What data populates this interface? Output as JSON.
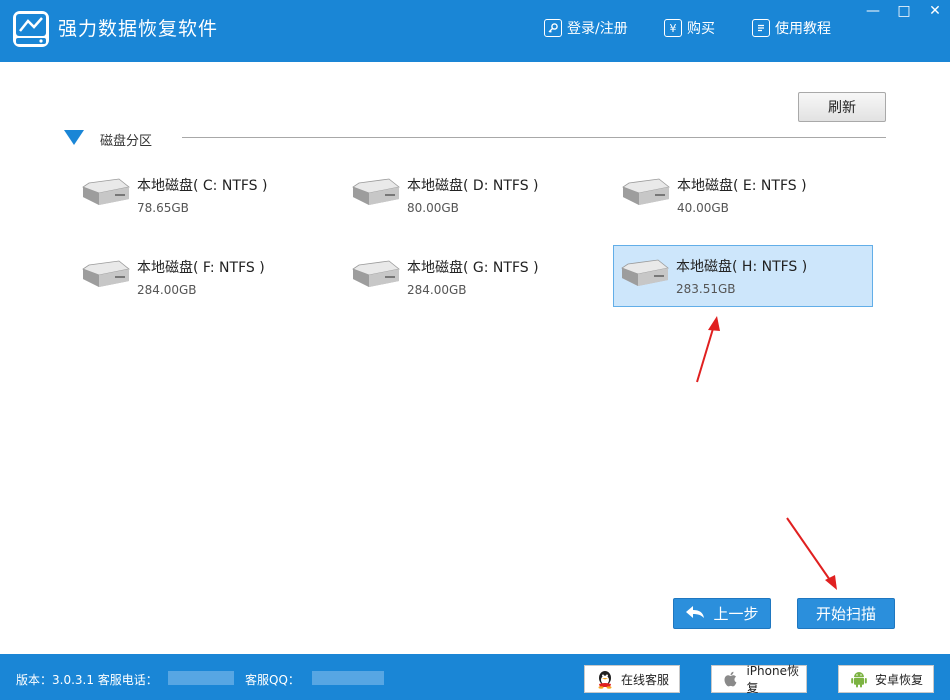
{
  "app": {
    "title": "强力数据恢复软件"
  },
  "header": {
    "login_label": "登录/注册",
    "buy_label": "购买",
    "buy_icon_glyph": "¥",
    "tutorial_label": "使用教程",
    "window_controls": [
      "—",
      "□",
      "✕"
    ]
  },
  "toolbar": {
    "refresh_label": "刷新"
  },
  "section": {
    "title": "磁盘分区"
  },
  "drives": [
    {
      "name": "本地磁盘( C: NTFS )",
      "size": "78.65GB"
    },
    {
      "name": "本地磁盘( D: NTFS )",
      "size": "80.00GB"
    },
    {
      "name": "本地磁盘( E: NTFS )",
      "size": "40.00GB"
    },
    {
      "name": "本地磁盘( F: NTFS )",
      "size": "284.00GB"
    },
    {
      "name": "本地磁盘( G: NTFS )",
      "size": "284.00GB"
    },
    {
      "name": "本地磁盘( H: NTFS )",
      "size": "283.51GB"
    }
  ],
  "selected_drive": "H",
  "actions": {
    "back_label": "上一步",
    "start_scan_label": "开始扫描"
  },
  "footer": {
    "version_label": "版本：3.0.3.1  客服电话：",
    "qq_label": "客服QQ：",
    "online_service_label": "在线客服",
    "iphone_recovery_label": "iPhone恢复",
    "android_recovery_label": "安卓恢复"
  },
  "colors": {
    "brand_blue": "#1a86d6",
    "selected_bg": "#cde6fb",
    "annotation_red": "#e02020"
  }
}
